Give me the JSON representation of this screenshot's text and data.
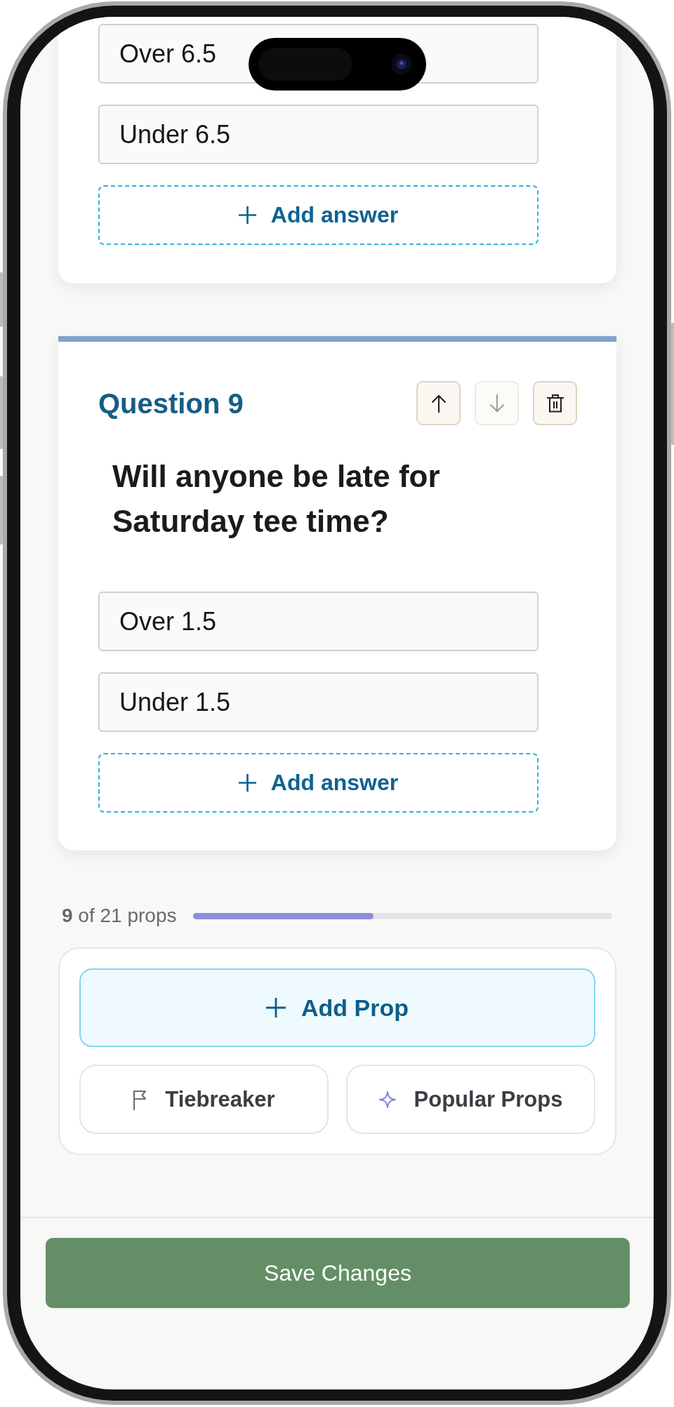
{
  "previous_question": {
    "answers": [
      {
        "value": "Over 6.5"
      },
      {
        "value": "Under 6.5"
      }
    ],
    "add_answer": "Add answer"
  },
  "question": {
    "title": "Question 9",
    "actions": [
      {
        "kind": "move_up",
        "disabled": false
      },
      {
        "kind": "move_down",
        "disabled": true
      },
      {
        "kind": "delete",
        "disabled": false
      }
    ],
    "text": "Will anyone be late for Saturday tee time?",
    "answers": [
      {
        "value": "Over 1.5"
      },
      {
        "value": "Under 1.5"
      }
    ],
    "add_answer": "Add answer"
  },
  "progress": {
    "label": "**9** of 21 props",
    "level": 0.43
  },
  "prop_actions": {
    "primary": "Add Prop",
    "secondary": [
      {
        "kind": "tiebreaker",
        "label": "Tiebreaker"
      },
      {
        "kind": "popular",
        "label": "Popular Props"
      }
    ]
  },
  "save_button": "Save Changes"
}
